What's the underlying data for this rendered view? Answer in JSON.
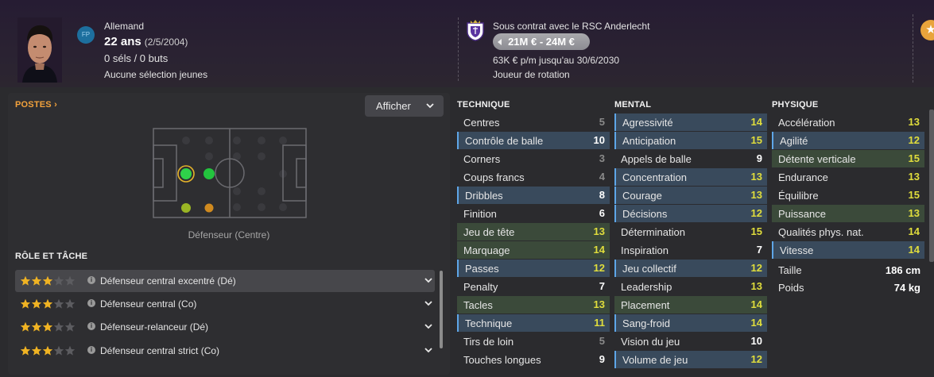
{
  "header": {
    "nationality": "Allemand",
    "age": "22 ans",
    "dob": "(2/5/2004)",
    "caps": "0 séls / 0 buts",
    "youth_caps": "Aucune sélection jeunes",
    "position_badge": "FP",
    "contract": "Sous contrat avec le RSC Anderlecht",
    "value": "21M € - 24M €",
    "wage": "63K € p/m jusqu'au 30/6/2030",
    "squad_role": "Joueur de rotation",
    "favourite_icon": "star-icon"
  },
  "positions": {
    "title": "POSTES",
    "show_button": "Afficher",
    "position_name": "Défenseur (Centre)"
  },
  "roles": {
    "title": "RÔLE ET TÂCHE",
    "items": [
      {
        "label": "Défenseur central excentré (Dé)",
        "stars": 3,
        "selected": true
      },
      {
        "label": "Défenseur central (Co)",
        "stars": 3,
        "selected": false
      },
      {
        "label": "Défenseur-relanceur (Dé)",
        "stars": 3,
        "selected": false
      },
      {
        "label": "Défenseur central strict (Co)",
        "stars": 3,
        "selected": false
      }
    ]
  },
  "technique": {
    "title": "TECHNIQUE",
    "rows": [
      {
        "label": "Centres",
        "value": "5"
      },
      {
        "label": "Contrôle de balle",
        "value": "10"
      },
      {
        "label": "Corners",
        "value": "3"
      },
      {
        "label": "Coups francs",
        "value": "4"
      },
      {
        "label": "Dribbles",
        "value": "8"
      },
      {
        "label": "Finition",
        "value": "6"
      },
      {
        "label": "Jeu de tête",
        "value": "13"
      },
      {
        "label": "Marquage",
        "value": "14"
      },
      {
        "label": "Passes",
        "value": "12"
      },
      {
        "label": "Penalty",
        "value": "7"
      },
      {
        "label": "Tacles",
        "value": "13"
      },
      {
        "label": "Technique",
        "value": "11"
      },
      {
        "label": "Tirs de loin",
        "value": "5"
      },
      {
        "label": "Touches longues",
        "value": "9"
      }
    ]
  },
  "mental": {
    "title": "MENTAL",
    "rows": [
      {
        "label": "Agressivité",
        "value": "14"
      },
      {
        "label": "Anticipation",
        "value": "15"
      },
      {
        "label": "Appels de balle",
        "value": "9"
      },
      {
        "label": "Concentration",
        "value": "13"
      },
      {
        "label": "Courage",
        "value": "13"
      },
      {
        "label": "Décisions",
        "value": "12"
      },
      {
        "label": "Détermination",
        "value": "15"
      },
      {
        "label": "Inspiration",
        "value": "7"
      },
      {
        "label": "Jeu collectif",
        "value": "12"
      },
      {
        "label": "Leadership",
        "value": "13"
      },
      {
        "label": "Placement",
        "value": "14"
      },
      {
        "label": "Sang-froid",
        "value": "14"
      },
      {
        "label": "Vision du jeu",
        "value": "10"
      },
      {
        "label": "Volume de jeu",
        "value": "12"
      }
    ]
  },
  "physique": {
    "title": "PHYSIQUE",
    "rows": [
      {
        "label": "Accélération",
        "value": "13"
      },
      {
        "label": "Agilité",
        "value": "12"
      },
      {
        "label": "Détente verticale",
        "value": "15"
      },
      {
        "label": "Endurance",
        "value": "13"
      },
      {
        "label": "Équilibre",
        "value": "15"
      },
      {
        "label": "Puissance",
        "value": "13"
      },
      {
        "label": "Qualités phys. nat.",
        "value": "14"
      },
      {
        "label": "Vitesse",
        "value": "14"
      }
    ],
    "height_label": "Taille",
    "height_value": "186 cm",
    "weight_label": "Poids",
    "weight_value": "74 kg"
  },
  "colors": {
    "accent_orange": "#f2a23c",
    "highlight_value": "#e0dd3c",
    "key_attr_blue": "#394a5c",
    "key_attr_green": "#3b4a3a",
    "position_natural": "#2fd24a",
    "position_accomplished": "#9ab524",
    "position_unconvincing": "#d08a1f"
  }
}
